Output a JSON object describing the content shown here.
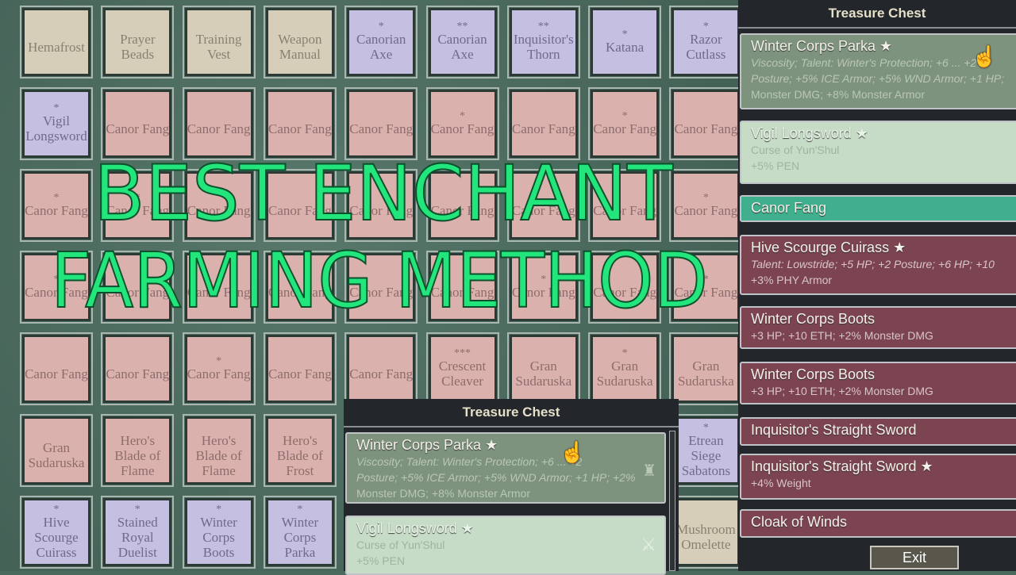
{
  "grid": [
    [
      {
        "n": "Hemafrost",
        "s": "",
        "c": "beige"
      },
      {
        "n": "Prayer Beads",
        "s": "",
        "c": "beige"
      },
      {
        "n": "Training Vest",
        "s": "",
        "c": "beige"
      },
      {
        "n": "Weapon Manual",
        "s": "",
        "c": "beige"
      },
      {
        "n": "Canorian Axe",
        "s": "*",
        "c": "purple"
      },
      {
        "n": "Canorian Axe",
        "s": "**",
        "c": "purple"
      },
      {
        "n": "Inquisitor's Thorn",
        "s": "**",
        "c": "purple"
      },
      {
        "n": "Katana",
        "s": "*",
        "c": "purple"
      },
      {
        "n": "Razor Cutlass",
        "s": "*",
        "c": "purple"
      }
    ],
    [
      {
        "n": "Vigil Longsword",
        "s": "*",
        "c": "purple"
      },
      {
        "n": "Canor Fang",
        "s": "",
        "c": "pink"
      },
      {
        "n": "Canor Fang",
        "s": "",
        "c": "pink"
      },
      {
        "n": "Canor Fang",
        "s": "",
        "c": "pink"
      },
      {
        "n": "Canor Fang",
        "s": "",
        "c": "pink"
      },
      {
        "n": "Canor Fang",
        "s": "*",
        "c": "pink"
      },
      {
        "n": "Canor Fang",
        "s": "",
        "c": "pink"
      },
      {
        "n": "Canor Fang",
        "s": "*",
        "c": "pink"
      },
      {
        "n": "Canor Fang",
        "s": "",
        "c": "pink"
      }
    ],
    [
      {
        "n": "Canor Fang",
        "s": "*",
        "c": "pink"
      },
      {
        "n": "Canor Fang",
        "s": "*",
        "c": "pink"
      },
      {
        "n": "Canor Fang",
        "s": "",
        "c": "pink"
      },
      {
        "n": "Canor Fang",
        "s": "",
        "c": "pink"
      },
      {
        "n": "Canor Fang",
        "s": "",
        "c": "pink"
      },
      {
        "n": "Canor Fang",
        "s": "",
        "c": "pink"
      },
      {
        "n": "Canor Fang",
        "s": "",
        "c": "pink"
      },
      {
        "n": "Canor Fang",
        "s": "",
        "c": "pink"
      },
      {
        "n": "Canor Fang",
        "s": "*",
        "c": "pink"
      }
    ],
    [
      {
        "n": "Canor Fang",
        "s": "*",
        "c": "pink"
      },
      {
        "n": "Canor Fang",
        "s": "",
        "c": "pink"
      },
      {
        "n": "Canor Fang",
        "s": "",
        "c": "pink"
      },
      {
        "n": "Canor Fang",
        "s": "",
        "c": "pink"
      },
      {
        "n": "Canor Fang",
        "s": "",
        "c": "pink"
      },
      {
        "n": "Canor Fang",
        "s": "",
        "c": "pink"
      },
      {
        "n": "Canor Fang",
        "s": "*",
        "c": "pink"
      },
      {
        "n": "Canor Fang",
        "s": "",
        "c": "pink"
      },
      {
        "n": "Canor Fang",
        "s": "*",
        "c": "pink"
      }
    ],
    [
      {
        "n": "Canor Fang",
        "s": "",
        "c": "pink"
      },
      {
        "n": "Canor Fang",
        "s": "",
        "c": "pink"
      },
      {
        "n": "Canor Fang",
        "s": "*",
        "c": "pink"
      },
      {
        "n": "Canor Fang",
        "s": "",
        "c": "pink"
      },
      {
        "n": "Canor Fang",
        "s": "",
        "c": "pink"
      },
      {
        "n": "Crescent Cleaver",
        "s": "***",
        "c": "pink"
      },
      {
        "n": "Gran Sudaruska",
        "s": "",
        "c": "pink"
      },
      {
        "n": "Gran Sudaruska",
        "s": "*",
        "c": "pink"
      },
      {
        "n": "Gran Sudaruska",
        "s": "",
        "c": "pink"
      }
    ],
    [
      {
        "n": "Gran Sudaruska",
        "s": "",
        "c": "pink"
      },
      {
        "n": "Hero's Blade of Flame",
        "s": "",
        "c": "pink"
      },
      {
        "n": "Hero's Blade of Flame",
        "s": "",
        "c": "pink"
      },
      {
        "n": "Hero's Blade of Frost",
        "s": "",
        "c": "pink"
      },
      null,
      null,
      null,
      null,
      {
        "n": "Etrean Siege Sabatons",
        "s": "*",
        "c": "purple"
      }
    ],
    [
      {
        "n": "Hive Scourge Cuirass",
        "s": "*",
        "c": "purple"
      },
      {
        "n": "Stained Royal Duelist",
        "s": "*",
        "c": "purple"
      },
      {
        "n": "Winter Corps Boots",
        "s": "*",
        "c": "purple"
      },
      {
        "n": "Winter Corps Parka",
        "s": "*",
        "c": "purple"
      },
      null,
      null,
      null,
      null,
      {
        "n": "Mushroom Omelette",
        "s": "",
        "c": "beige"
      }
    ]
  ],
  "overlay": {
    "line1": "BEST ENCHANT",
    "line2": "FARMING METHOD",
    "color": "#22e67c"
  },
  "chest_small": {
    "title": "Treasure Chest",
    "items": [
      {
        "name": "Winter Corps Parka ★",
        "desc1": "Viscosity; Talent: Winter's Protection; +6 ... +2",
        "desc2": "Posture; +5% ICE Armor; +5% WND Armor; +1 HP; +2%",
        "desc3": "Monster DMG; +8% Monster Armor"
      },
      {
        "name": "Vigil Longsword ★",
        "desc1": "Curse of Yun'Shul",
        "desc2": "+5% PEN"
      }
    ]
  },
  "chest": {
    "title": "Treasure Chest",
    "exit_label": "Exit",
    "items": [
      {
        "name": "Winter Corps Parka ★",
        "desc": [
          "Viscosity; Talent: Winter's Protection; +6 ... +2",
          "Posture; +5% ICE Armor; +5% WND Armor; +1 HP;",
          "Monster DMG; +8% Monster Armor"
        ],
        "color": "#7e937e"
      },
      {
        "name": "Vigil Longsword ★",
        "desc": [
          "Curse of Yun'Shul",
          "+5% PEN"
        ],
        "color": "#c7dcc7"
      },
      {
        "name": "Canor Fang",
        "desc": [],
        "color": "#3faf8d"
      },
      {
        "name": "Hive Scourge Cuirass ★",
        "desc": [
          "Talent: Lowstride; +5 HP; +2 Posture; +6 HP; +10",
          "+3% PHY Armor"
        ],
        "color": "#7c4450"
      },
      {
        "name": "Winter Corps Boots",
        "desc": [
          "+3 HP; +10 ETH; +2% Monster DMG"
        ],
        "color": "#7c4450"
      },
      {
        "name": "Winter Corps Boots",
        "desc": [
          "+3 HP; +10 ETH; +2% Monster DMG"
        ],
        "color": "#7c4450"
      },
      {
        "name": "Inquisitor's Straight Sword",
        "desc": [],
        "color": "#7c4450"
      },
      {
        "name": "Inquisitor's Straight Sword ★",
        "desc": [
          "+4% Weight"
        ],
        "color": "#7c4450"
      },
      {
        "name": "Cloak of Winds",
        "desc": [],
        "color": "#7c4450"
      }
    ]
  }
}
